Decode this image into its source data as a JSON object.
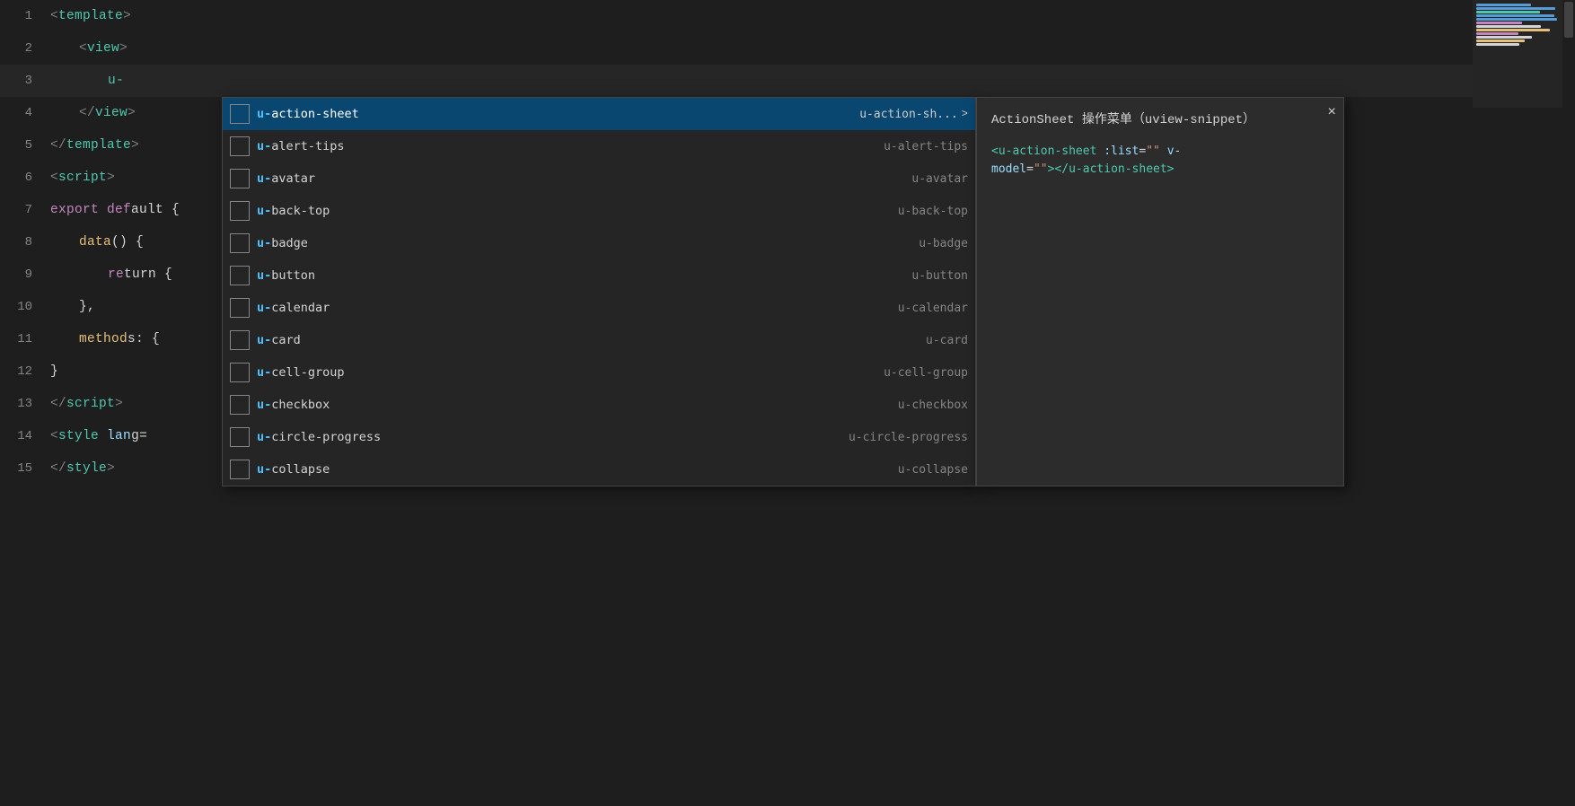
{
  "editor": {
    "lines": [
      {
        "num": 1,
        "indent": 0,
        "content_html": "<span class='tag-bracket'>&lt;</span><span class='tag'>template</span><span class='tag-bracket'>&gt;</span>"
      },
      {
        "num": 2,
        "indent": 4,
        "content_html": "<span class='tag-bracket'>&lt;</span><span class='tag'>view</span><span class='tag-bracket'>&gt;</span>"
      },
      {
        "num": 3,
        "indent": 8,
        "content_html": "<span class='cyan'>u-</span>"
      },
      {
        "num": 4,
        "indent": 4,
        "content_html": "<span class='tag-bracket'>&lt;/</span><span class='tag'>view</span><span class='tag-bracket'>&gt;</span>"
      },
      {
        "num": 5,
        "indent": 0,
        "content_html": "<span class='tag-bracket'>&lt;/</span><span class='tag'>template</span><span class='tag-bracket'>&gt;</span>"
      },
      {
        "num": 6,
        "indent": 0,
        "content_html": "<span class='tag-bracket'>&lt;</span><span class='tag'>script</span><span class='tag-bracket'>&gt;</span>"
      },
      {
        "num": 7,
        "indent": 0,
        "content_html": "<span class='pink'>export</span> <span class='pink'>def</span><span class='white'>ault {</span>"
      },
      {
        "num": 8,
        "indent": 4,
        "content_html": "<span class='yellow'>data</span><span class='white'>()</span> <span class='white'>{</span>"
      },
      {
        "num": 9,
        "indent": 8,
        "content_html": "<span class='pink'>re</span><span class='white'>turn {</span>"
      },
      {
        "num": 10,
        "indent": 4,
        "content_html": "<span class='white'>},</span>"
      },
      {
        "num": 11,
        "indent": 4,
        "content_html": "<span class='yellow'>method</span><span class='white'>s: {</span>"
      },
      {
        "num": 12,
        "indent": 0,
        "content_html": "<span class='white'>}</span>"
      },
      {
        "num": 13,
        "indent": 0,
        "content_html": "<span class='tag-bracket'>&lt;/</span><span class='tag'>script</span><span class='tag-bracket'>&gt;</span>"
      },
      {
        "num": 14,
        "indent": 0,
        "content_html": "<span class='tag-bracket'>&lt;</span><span class='tag'>style</span> <span class='property'>lan</span><span class='white'>g=</span>"
      },
      {
        "num": 15,
        "indent": 0,
        "content_html": "<span class='tag-bracket'>&lt;/</span><span class='tag'>style</span><span class='tag-bracket'>&gt;</span>"
      }
    ]
  },
  "autocomplete": {
    "items": [
      {
        "label_prefix": "u-",
        "label_rest": "action-sheet",
        "detail": "u-action-sh...",
        "arrow": ">",
        "selected": true
      },
      {
        "label_prefix": "u-",
        "label_rest": "alert-tips",
        "detail": "u-alert-tips",
        "arrow": "",
        "selected": false
      },
      {
        "label_prefix": "u-",
        "label_rest": "avatar",
        "detail": "u-avatar",
        "arrow": "",
        "selected": false
      },
      {
        "label_prefix": "u-",
        "label_rest": "back-top",
        "detail": "u-back-top",
        "arrow": "",
        "selected": false
      },
      {
        "label_prefix": "u-",
        "label_rest": "badge",
        "detail": "u-badge",
        "arrow": "",
        "selected": false
      },
      {
        "label_prefix": "u-",
        "label_rest": "button",
        "detail": "u-button",
        "arrow": "",
        "selected": false
      },
      {
        "label_prefix": "u-",
        "label_rest": "calendar",
        "detail": "u-calendar",
        "arrow": "",
        "selected": false
      },
      {
        "label_prefix": "u-",
        "label_rest": "card",
        "detail": "u-card",
        "arrow": "",
        "selected": false
      },
      {
        "label_prefix": "u-",
        "label_rest": "cell-group",
        "detail": "u-cell-group",
        "arrow": "",
        "selected": false
      },
      {
        "label_prefix": "u-",
        "label_rest": "checkbox",
        "detail": "u-checkbox",
        "arrow": "",
        "selected": false
      },
      {
        "label_prefix": "u-",
        "label_rest": "circle-progress",
        "detail": "u-circle-progress",
        "arrow": "",
        "selected": false
      },
      {
        "label_prefix": "u-",
        "label_rest": "collapse",
        "detail": "u-collapse",
        "arrow": "",
        "selected": false
      }
    ]
  },
  "doc_panel": {
    "title": "ActionSheet 操作菜单（uview-snippet）",
    "code_line1": "<u-action-sheet :list=\"\" v-",
    "code_line2": "model=\"\"></u-action-sheet>",
    "close_icon": "×"
  },
  "minimap": {
    "lines": [
      "#569cd6",
      "#569cd6",
      "#4ec9b0",
      "#569cd6",
      "#569cd6",
      "#c586c0",
      "#d4d4d4",
      "#e5c07b",
      "#c586c0",
      "#d4d4d4",
      "#e5c07b",
      "#d4d4d4"
    ]
  }
}
